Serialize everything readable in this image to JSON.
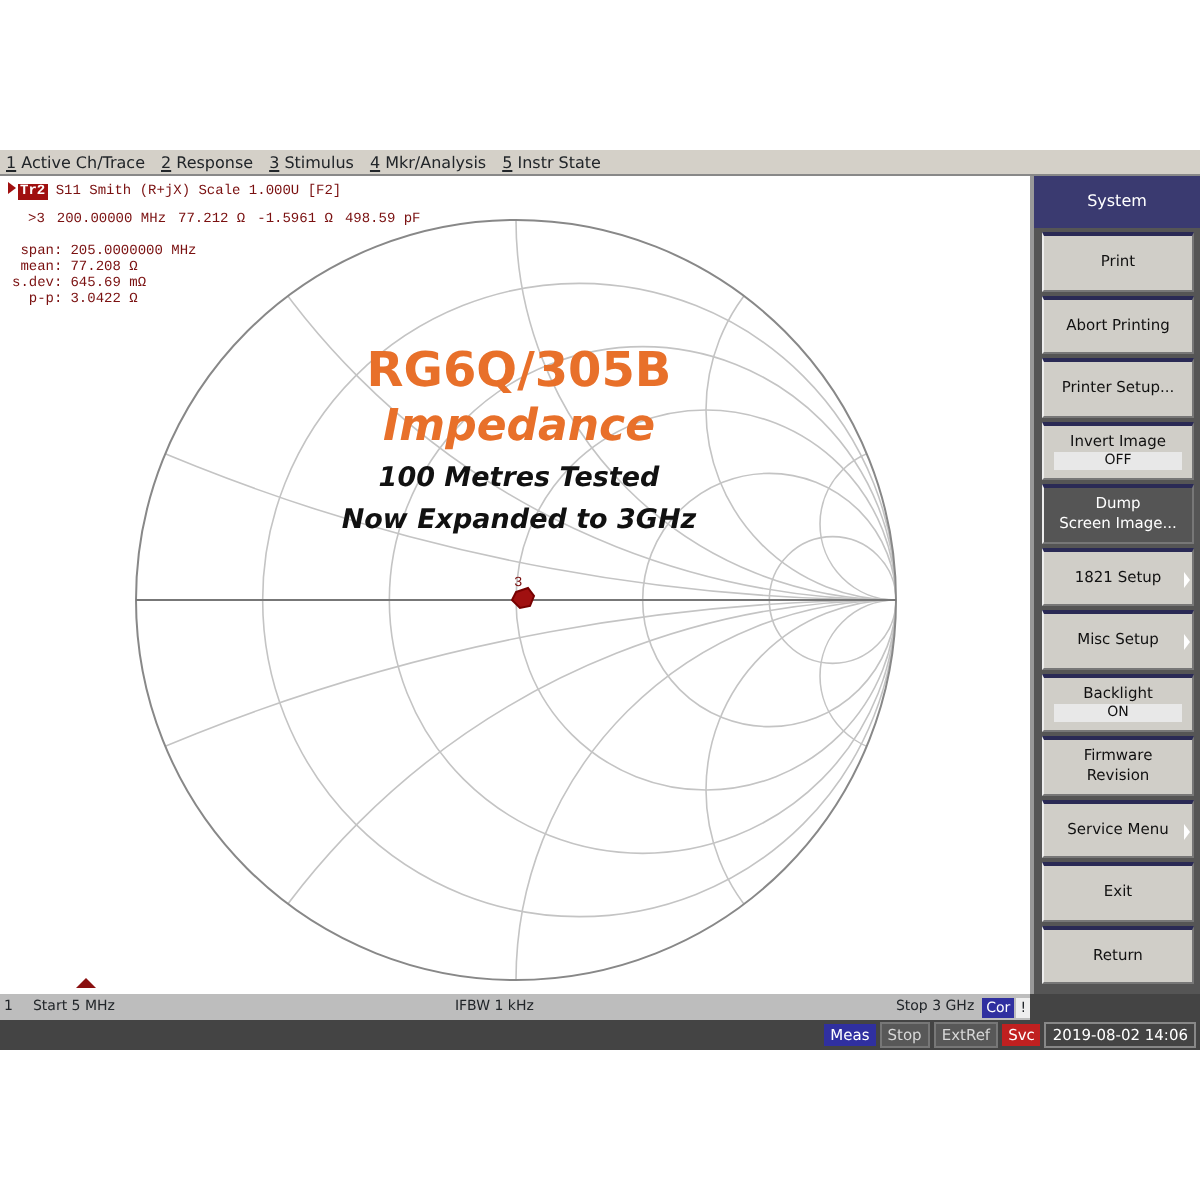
{
  "menu": [
    {
      "key": "1",
      "label": "Active Ch/Trace"
    },
    {
      "key": "2",
      "label": "Response"
    },
    {
      "key": "3",
      "label": "Stimulus"
    },
    {
      "key": "4",
      "label": "Mkr/Analysis"
    },
    {
      "key": "5",
      "label": "Instr State"
    }
  ],
  "trace": {
    "badge": "Tr2",
    "header": "S11 Smith (R+jX) Scale 1.000U [F2]"
  },
  "marker_readout": {
    "id": ">3",
    "frequency": "200.00000 MHz",
    "resistance": "77.212 Ω",
    "reactance": "-1.5961 Ω",
    "component": "498.59 pF"
  },
  "statistics": [
    {
      "label": "span:",
      "value": "205.0000000 MHz"
    },
    {
      "label": "mean:",
      "value": "77.208 Ω"
    },
    {
      "label": "s.dev:",
      "value": "645.69 mΩ"
    },
    {
      "label": "p-p:",
      "value": "3.0422 Ω"
    }
  ],
  "overlay": {
    "title": "RG6Q/305B",
    "subtitle": "Impedance",
    "lines": [
      "100 Metres Tested",
      "Now Expanded to 3GHz"
    ]
  },
  "chart_marker": "3",
  "softkey_title": "System",
  "softkeys": [
    {
      "lines": [
        "Print"
      ],
      "selected": false,
      "submenu": false
    },
    {
      "lines": [
        "Abort Printing"
      ],
      "selected": false,
      "submenu": false
    },
    {
      "lines": [
        "Printer Setup..."
      ],
      "selected": false,
      "submenu": false
    },
    {
      "lines": [
        "Invert Image"
      ],
      "value": "OFF",
      "selected": false,
      "submenu": false
    },
    {
      "lines": [
        "Dump",
        "Screen Image..."
      ],
      "selected": true,
      "submenu": false
    },
    {
      "lines": [
        "1821 Setup"
      ],
      "selected": false,
      "submenu": true
    },
    {
      "lines": [
        "Misc Setup"
      ],
      "selected": false,
      "submenu": true
    },
    {
      "lines": [
        "Backlight"
      ],
      "value": "ON",
      "selected": false,
      "submenu": false
    },
    {
      "lines": [
        "Firmware",
        "Revision"
      ],
      "selected": false,
      "submenu": false
    },
    {
      "lines": [
        "Service Menu"
      ],
      "selected": false,
      "submenu": true
    },
    {
      "lines": [
        "Exit"
      ],
      "selected": false,
      "submenu": false
    },
    {
      "lines": [
        "Return"
      ],
      "selected": false,
      "submenu": false
    }
  ],
  "status_line": {
    "channel": "1",
    "start": "Start 5 MHz",
    "ifbw": "IFBW 1 kHz",
    "stop": "Stop 3 GHz",
    "correction": "Cor",
    "warning": "!"
  },
  "indicators": [
    {
      "label": "Meas",
      "active": true,
      "color": "#3030a0"
    },
    {
      "label": "Stop",
      "active": false,
      "color": "#585858"
    },
    {
      "label": "ExtRef",
      "active": false,
      "color": "#585858"
    },
    {
      "label": "Svc",
      "active": true,
      "color": "#c02020"
    }
  ],
  "datetime": "2019-08-02 14:06"
}
